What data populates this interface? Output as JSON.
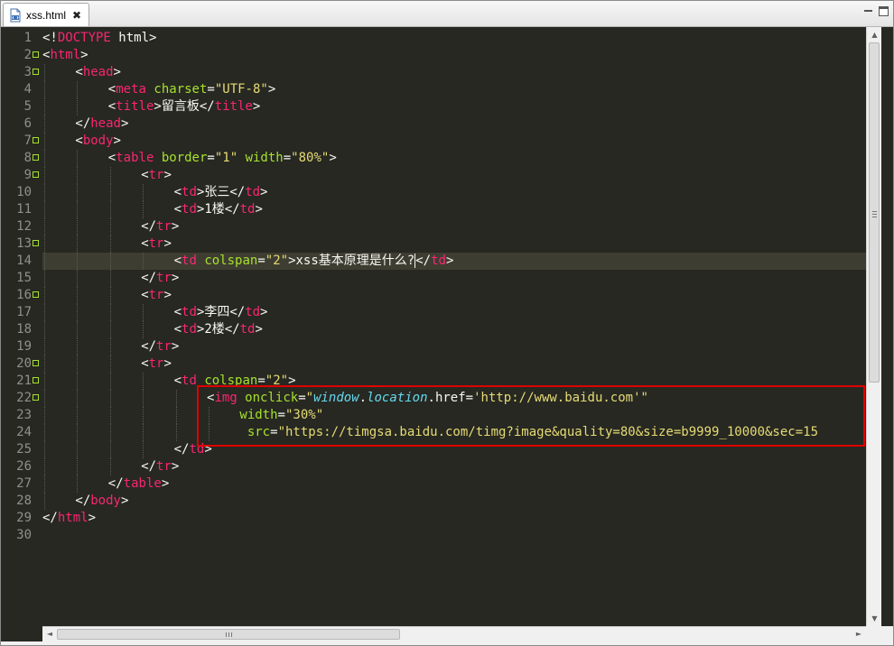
{
  "tab": {
    "title": "xss.html",
    "close": "✖",
    "icon": "html-file-icon"
  },
  "window_controls": {
    "minimize": "minimize-icon",
    "maximize": "maximize-icon"
  },
  "editor": {
    "current_line": 14,
    "lines": [
      {
        "n": "1",
        "fold": false,
        "indent": 0,
        "tokens": [
          [
            "p",
            "<!"
          ],
          [
            "d",
            "DOCTYPE"
          ],
          [
            "p",
            " html>"
          ]
        ]
      },
      {
        "n": "2",
        "fold": true,
        "indent": 0,
        "tokens": [
          [
            "p",
            "<"
          ],
          [
            "t",
            "html"
          ],
          [
            "p",
            ">"
          ]
        ]
      },
      {
        "n": "3",
        "fold": true,
        "indent": 1,
        "tokens": [
          [
            "p",
            "<"
          ],
          [
            "t",
            "head"
          ],
          [
            "p",
            ">"
          ]
        ]
      },
      {
        "n": "4",
        "fold": false,
        "indent": 2,
        "tokens": [
          [
            "p",
            "<"
          ],
          [
            "t",
            "meta"
          ],
          [
            "p",
            " "
          ],
          [
            "a",
            "charset"
          ],
          [
            "p",
            "="
          ],
          [
            "s",
            "\"UTF-8\""
          ],
          [
            "p",
            ">"
          ]
        ]
      },
      {
        "n": "5",
        "fold": false,
        "indent": 2,
        "tokens": [
          [
            "p",
            "<"
          ],
          [
            "t",
            "title"
          ],
          [
            "p",
            ">留言板</"
          ],
          [
            "t",
            "title"
          ],
          [
            "p",
            ">"
          ]
        ]
      },
      {
        "n": "6",
        "fold": false,
        "indent": 1,
        "tokens": [
          [
            "p",
            "</"
          ],
          [
            "t",
            "head"
          ],
          [
            "p",
            ">"
          ]
        ]
      },
      {
        "n": "7",
        "fold": true,
        "indent": 1,
        "tokens": [
          [
            "p",
            "<"
          ],
          [
            "t",
            "body"
          ],
          [
            "p",
            ">"
          ]
        ]
      },
      {
        "n": "8",
        "fold": true,
        "indent": 2,
        "tokens": [
          [
            "p",
            "<"
          ],
          [
            "t",
            "table"
          ],
          [
            "p",
            " "
          ],
          [
            "a",
            "border"
          ],
          [
            "p",
            "="
          ],
          [
            "s",
            "\"1\""
          ],
          [
            "p",
            " "
          ],
          [
            "a",
            "width"
          ],
          [
            "p",
            "="
          ],
          [
            "s",
            "\"80%\""
          ],
          [
            "p",
            ">"
          ]
        ]
      },
      {
        "n": "9",
        "fold": true,
        "indent": 3,
        "tokens": [
          [
            "p",
            "<"
          ],
          [
            "t",
            "tr"
          ],
          [
            "p",
            ">"
          ]
        ]
      },
      {
        "n": "10",
        "fold": false,
        "indent": 4,
        "tokens": [
          [
            "p",
            "<"
          ],
          [
            "t",
            "td"
          ],
          [
            "p",
            ">张三</"
          ],
          [
            "t",
            "td"
          ],
          [
            "p",
            ">"
          ]
        ]
      },
      {
        "n": "11",
        "fold": false,
        "indent": 4,
        "tokens": [
          [
            "p",
            "<"
          ],
          [
            "t",
            "td"
          ],
          [
            "p",
            ">1楼</"
          ],
          [
            "t",
            "td"
          ],
          [
            "p",
            ">"
          ]
        ]
      },
      {
        "n": "12",
        "fold": false,
        "indent": 3,
        "tokens": [
          [
            "p",
            "</"
          ],
          [
            "t",
            "tr"
          ],
          [
            "p",
            ">"
          ]
        ]
      },
      {
        "n": "13",
        "fold": true,
        "indent": 3,
        "tokens": [
          [
            "p",
            "<"
          ],
          [
            "t",
            "tr"
          ],
          [
            "p",
            ">"
          ]
        ]
      },
      {
        "n": "14",
        "fold": false,
        "indent": 4,
        "tokens": [
          [
            "p",
            "<"
          ],
          [
            "t",
            "td"
          ],
          [
            "p",
            " "
          ],
          [
            "a",
            "colspan"
          ],
          [
            "p",
            "="
          ],
          [
            "s",
            "\"2\""
          ],
          [
            "p",
            ">xss基本原理是什么?"
          ],
          [
            "c",
            ""
          ],
          [
            "p",
            "</"
          ],
          [
            "t",
            "td"
          ],
          [
            "p",
            ">"
          ]
        ]
      },
      {
        "n": "15",
        "fold": false,
        "indent": 3,
        "tokens": [
          [
            "p",
            "</"
          ],
          [
            "t",
            "tr"
          ],
          [
            "p",
            ">"
          ]
        ]
      },
      {
        "n": "16",
        "fold": true,
        "indent": 3,
        "tokens": [
          [
            "p",
            "<"
          ],
          [
            "t",
            "tr"
          ],
          [
            "p",
            ">"
          ]
        ]
      },
      {
        "n": "17",
        "fold": false,
        "indent": 4,
        "tokens": [
          [
            "p",
            "<"
          ],
          [
            "t",
            "td"
          ],
          [
            "p",
            ">李四</"
          ],
          [
            "t",
            "td"
          ],
          [
            "p",
            ">"
          ]
        ]
      },
      {
        "n": "18",
        "fold": false,
        "indent": 4,
        "tokens": [
          [
            "p",
            "<"
          ],
          [
            "t",
            "td"
          ],
          [
            "p",
            ">2楼</"
          ],
          [
            "t",
            "td"
          ],
          [
            "p",
            ">"
          ]
        ]
      },
      {
        "n": "19",
        "fold": false,
        "indent": 3,
        "tokens": [
          [
            "p",
            "</"
          ],
          [
            "t",
            "tr"
          ],
          [
            "p",
            ">"
          ]
        ]
      },
      {
        "n": "20",
        "fold": true,
        "indent": 3,
        "tokens": [
          [
            "p",
            "<"
          ],
          [
            "t",
            "tr"
          ],
          [
            "p",
            ">"
          ]
        ]
      },
      {
        "n": "21",
        "fold": true,
        "indent": 4,
        "tokens": [
          [
            "p",
            "<"
          ],
          [
            "t",
            "td"
          ],
          [
            "p",
            " "
          ],
          [
            "a",
            "colspan"
          ],
          [
            "p",
            "="
          ],
          [
            "s",
            "\"2\""
          ],
          [
            "p",
            ">"
          ]
        ]
      },
      {
        "n": "22",
        "fold": true,
        "indent": 5,
        "tokens": [
          [
            "p",
            "<"
          ],
          [
            "t",
            "img"
          ],
          [
            "p",
            " "
          ],
          [
            "a",
            "onclick"
          ],
          [
            "p",
            "="
          ],
          [
            "s",
            "\""
          ],
          [
            "js",
            "window"
          ],
          [
            "p",
            "."
          ],
          [
            "js",
            "location"
          ],
          [
            "p",
            ".href="
          ],
          [
            "s",
            "'http://www.baidu.com'\""
          ]
        ]
      },
      {
        "n": "23",
        "fold": false,
        "indent": 6,
        "tokens": [
          [
            "a",
            "width"
          ],
          [
            "p",
            "="
          ],
          [
            "s",
            "\"30%\""
          ]
        ]
      },
      {
        "n": "24",
        "fold": false,
        "indent": 6,
        "tokens": [
          [
            "p",
            " "
          ],
          [
            "a",
            "src"
          ],
          [
            "p",
            "="
          ],
          [
            "s",
            "\"https://timgsa.baidu.com/timg?image&quality=80&size=b9999_10000&sec=15"
          ]
        ]
      },
      {
        "n": "25",
        "fold": false,
        "indent": 4,
        "tokens": [
          [
            "p",
            "</"
          ],
          [
            "t",
            "td"
          ],
          [
            "p",
            ">"
          ]
        ]
      },
      {
        "n": "26",
        "fold": false,
        "indent": 3,
        "tokens": [
          [
            "p",
            "</"
          ],
          [
            "t",
            "tr"
          ],
          [
            "p",
            ">"
          ]
        ]
      },
      {
        "n": "27",
        "fold": false,
        "indent": 2,
        "tokens": [
          [
            "p",
            "</"
          ],
          [
            "t",
            "table"
          ],
          [
            "p",
            ">"
          ]
        ]
      },
      {
        "n": "28",
        "fold": false,
        "indent": 1,
        "tokens": [
          [
            "p",
            "</"
          ],
          [
            "t",
            "body"
          ],
          [
            "p",
            ">"
          ]
        ]
      },
      {
        "n": "29",
        "fold": false,
        "indent": 0,
        "tokens": [
          [
            "p",
            "</"
          ],
          [
            "t",
            "html"
          ],
          [
            "p",
            ">"
          ]
        ]
      },
      {
        "n": "30",
        "fold": false,
        "indent": 0,
        "tokens": []
      }
    ]
  },
  "scrollbars": {
    "vertical_up": "▲",
    "vertical_down": "▼",
    "horizontal_left": "◄",
    "horizontal_right": "►"
  },
  "colors": {
    "background": "#272822",
    "tag": "#f92672",
    "attribute": "#a6e22e",
    "string": "#e6db74",
    "js": "#66d9ef",
    "highlight_box": "#e00000"
  }
}
